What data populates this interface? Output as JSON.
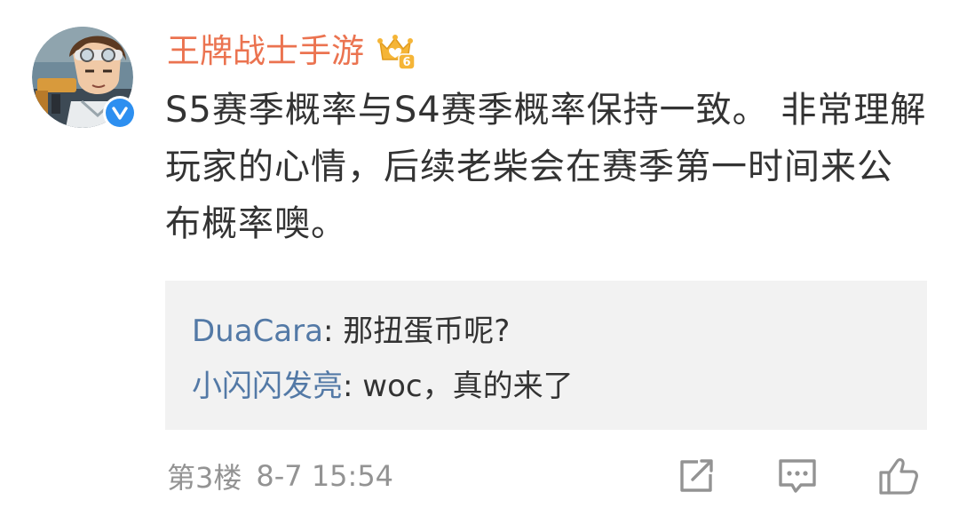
{
  "comment": {
    "username": "王牌战士手游",
    "vip_level": "6",
    "text": "S5赛季概率与S4赛季概率保持一致。 非常理解玩家的心情，后续老柴会在赛季第一时间来公布概率噢。",
    "floor": "第3楼",
    "time": "8-7 15:54"
  },
  "replies": [
    {
      "user": "DuaCara",
      "separator": ": ",
      "text": "那扭蛋币呢?"
    },
    {
      "user": "小闪闪发亮",
      "separator": ": ",
      "text": "woc，真的来了"
    }
  ],
  "icons": {
    "verified": "verified-badge-icon",
    "vip": "crown-vip-icon",
    "share": "share-icon",
    "comment": "comment-icon",
    "like": "like-icon"
  },
  "colors": {
    "username": "#eb7350",
    "reply_user": "#5379a6",
    "text": "#333333",
    "meta": "#939393",
    "reply_bg": "#f2f2f2",
    "verified": "#2d8ff0",
    "vip": "#f5b537"
  }
}
